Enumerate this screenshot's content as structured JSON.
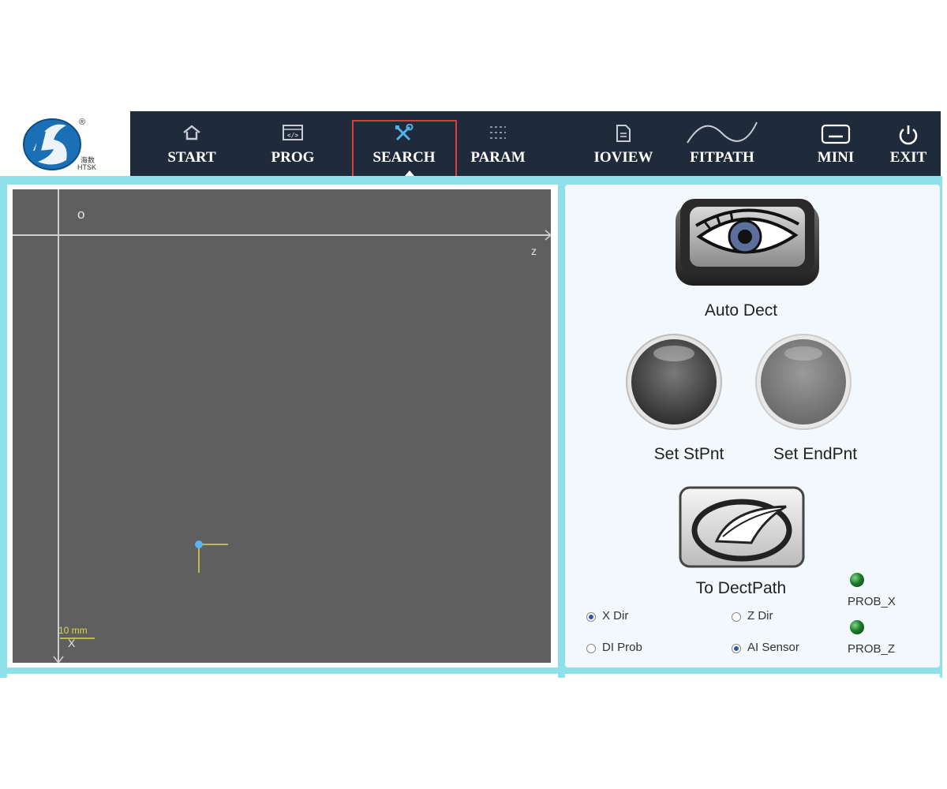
{
  "logo": {
    "text_cn": "海数",
    "text_en": "HTSK",
    "registered": "®"
  },
  "nav": {
    "items": [
      {
        "label": "START",
        "icon": "home-icon"
      },
      {
        "label": "PROG",
        "icon": "code-window-icon"
      },
      {
        "label": "SEARCH",
        "icon": "tools-icon",
        "selected": true
      },
      {
        "label": "PARAM",
        "icon": "list-settings-icon"
      },
      {
        "label": "IOVIEW",
        "icon": "document-icon"
      },
      {
        "label": "FITPATH",
        "icon": "curve-icon"
      },
      {
        "label": "MINI",
        "icon": "minimize-icon"
      },
      {
        "label": "EXIT",
        "icon": "power-icon"
      }
    ]
  },
  "canvas": {
    "origin_marker": "o",
    "z_axis_label": "z",
    "x_axis_label": "X",
    "scale_label": "10 mm"
  },
  "controls": {
    "auto_dect": "Auto Dect",
    "set_start": "Set StPnt",
    "set_end": "Set EndPnt",
    "to_path": "To DectPath"
  },
  "options": {
    "x_dir": "X Dir",
    "z_dir": "Z Dir",
    "di_prob": "DI Prob",
    "ai_sensor": "AI Sensor",
    "selected": [
      "X Dir",
      "AI Sensor"
    ]
  },
  "indicators": {
    "prob_x": "PROB_X",
    "prob_z": "PROB_Z"
  },
  "colors": {
    "navbar": "#1f2a3a",
    "frame": "#8ee0ea",
    "canvas": "#5f5f5f",
    "highlight": "#e23a3a",
    "led": "#1e7a2b",
    "logo_blue": "#1a6fb5"
  }
}
